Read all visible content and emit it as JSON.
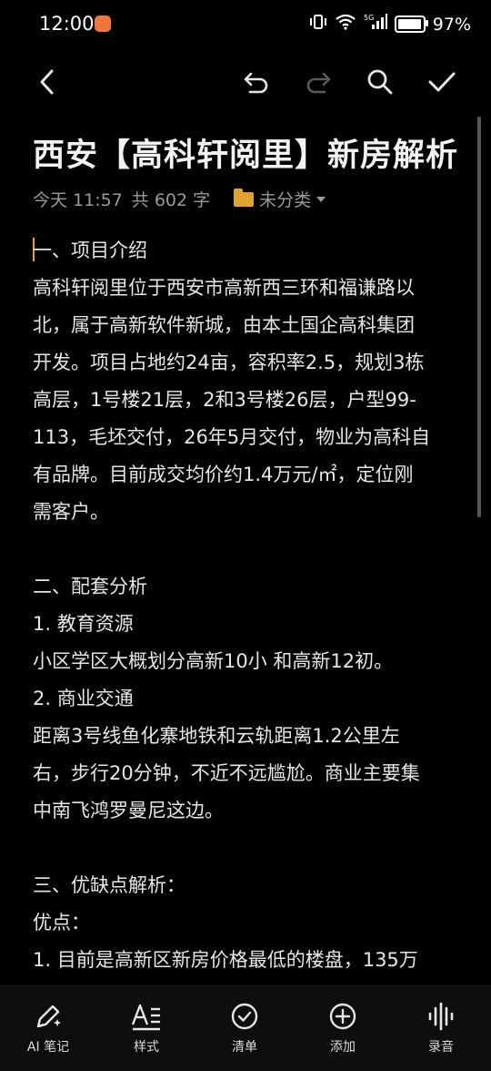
{
  "status_bar": {
    "time": "12:00",
    "battery_percent": "97%",
    "battery_level": 0.97,
    "network": "5G"
  },
  "toolbar": {
    "back": "back",
    "undo": "undo",
    "redo": "redo",
    "search": "search",
    "confirm": "confirm"
  },
  "note": {
    "title": "西安【高科轩阅里】新房解析",
    "date_label": "今天 11:57",
    "word_count": "共 602 字",
    "folder": "未分类",
    "lines": [
      "一、项目介绍",
      "高科轩阅里位于西安市高新西三环和福谦路以",
      "北，属于高新软件新城，由本土国企高科集团",
      "开发。项目占地约24亩，容积率2.5，规划3栋",
      "高层，1号楼21层，2和3号楼26层，户型99-",
      "113，毛坯交付，26年5月交付，物业为高科自",
      "有品牌。目前成交均价约1.4万元/㎡，定位刚",
      "需客户。",
      "",
      "二、配套分析",
      "1. 教育资源",
      "小区学区大概划分高新10小 和高新12初。",
      "2. 商业交通",
      "距离3号线鱼化寨地铁和云轨距离1.2公里左",
      "右，步行20分钟，不近不远尴尬。商业主要集",
      "中南飞鸿罗曼尼这边。",
      "",
      "三、优缺点解析：",
      "优点：",
      "1. 目前是高新区新房价格最低的楼盘，135万"
    ]
  },
  "bottom_bar": {
    "items": [
      {
        "label": "AI 笔记",
        "icon": "ai-pen-icon"
      },
      {
        "label": "样式",
        "icon": "text-style-icon"
      },
      {
        "label": "清单",
        "icon": "checklist-icon"
      },
      {
        "label": "添加",
        "icon": "add-icon"
      },
      {
        "label": "录音",
        "icon": "voice-record-icon"
      }
    ]
  },
  "colors": {
    "background": "#000000",
    "text": "#e6e6e6",
    "meta": "#9a9a9a",
    "accent": "#e0a330"
  }
}
